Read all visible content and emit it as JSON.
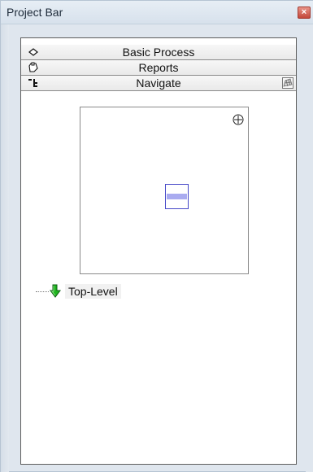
{
  "window": {
    "title": "Project Bar",
    "close_symbol": "×",
    "accent_color": "#c3473a"
  },
  "panel": {
    "sections": [
      {
        "label": "Basic Process",
        "icon": "diamond-icon"
      },
      {
        "label": "Reports",
        "icon": "clipboard-icon"
      },
      {
        "label": "Navigate",
        "icon": "tree-navigation-icon",
        "tool_icon": "overview-toggle-icon"
      }
    ]
  },
  "navigator": {
    "zoom_icon": "zoom-in-icon",
    "viewport_color": "#4749c8"
  },
  "tree": {
    "items": [
      {
        "label": "Top-Level",
        "icon": "green-down-arrow-icon"
      }
    ]
  }
}
